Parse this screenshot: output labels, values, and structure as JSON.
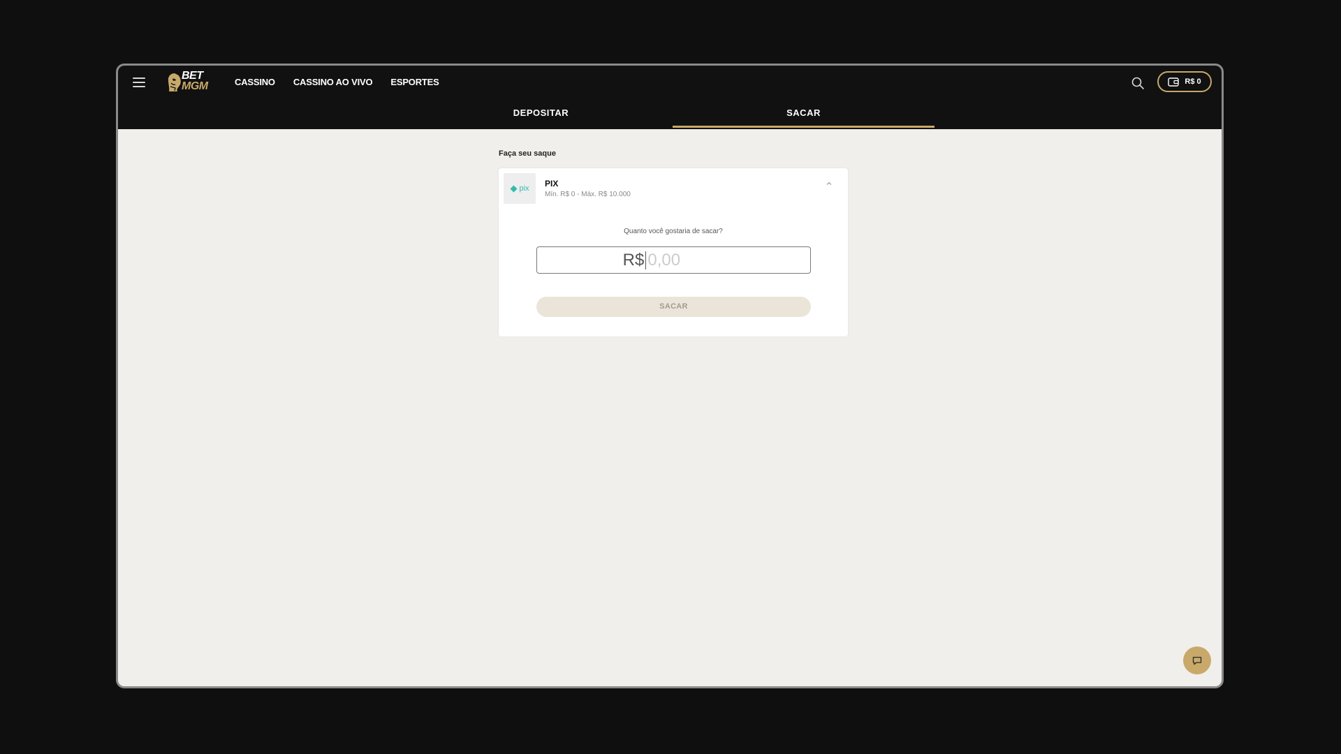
{
  "header": {
    "logo": {
      "line1": "BET",
      "line2": "MGM"
    },
    "nav": [
      "CASSINO",
      "CASSINO AO VIVO",
      "ESPORTES"
    ],
    "wallet_balance": "R$ 0",
    "icons": {
      "menu": "hamburger-icon",
      "search": "search-icon",
      "wallet": "wallet-icon"
    }
  },
  "tabs": {
    "deposit": "DEPOSITAR",
    "withdraw": "SACAR",
    "active": "withdraw"
  },
  "withdraw": {
    "section_title": "Faça seu saque",
    "method": {
      "name": "PIX",
      "logo_text": "pix",
      "limits": "Mín. R$ 0 - Máx. R$ 10.000"
    },
    "question": "Quanto você gostaria de sacar?",
    "currency": "R$",
    "amount_placeholder": "0,00",
    "submit_label": "SACAR"
  },
  "colors": {
    "brand_gold": "#c8a96a",
    "header_bg": "#111111",
    "page_bg": "#f1efeb",
    "pix_teal": "#32bcad"
  },
  "chat": {
    "icon": "chat-icon"
  }
}
